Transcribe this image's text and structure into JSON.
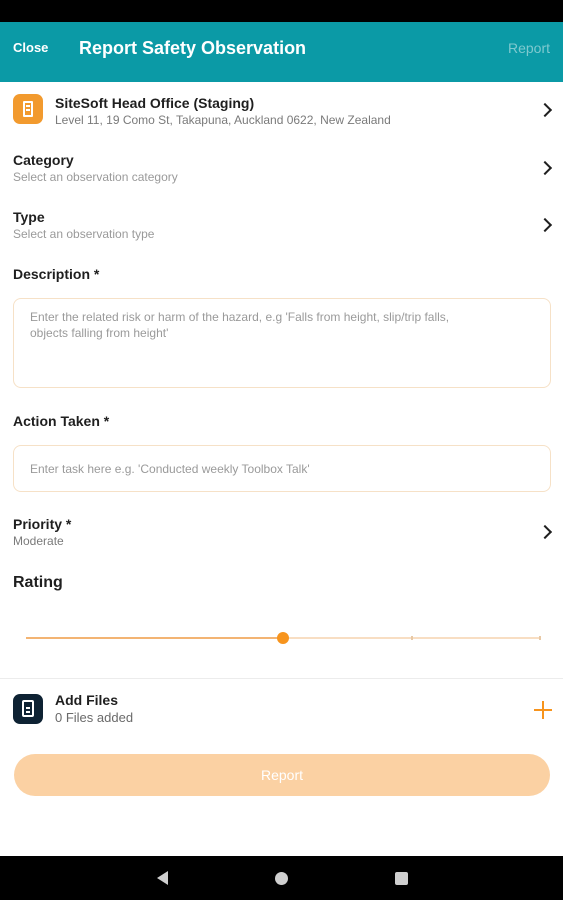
{
  "app_bar": {
    "close_label": "Close",
    "title": "Report Safety Observation",
    "report_label": "Report"
  },
  "site": {
    "icon": "building-icon",
    "name": "SiteSoft Head Office (Staging)",
    "address": "Level 11, 19 Como St, Takapuna, Auckland 0622, New Zealand"
  },
  "category": {
    "label": "Category",
    "placeholder": "Select an observation category"
  },
  "type": {
    "label": "Type",
    "placeholder": "Select an observation type"
  },
  "description": {
    "label": "Description *",
    "placeholder_line1": "Enter the related risk or harm of the hazard, e.g 'Falls from height, slip/trip falls,",
    "placeholder_line2": "objects falling from height'"
  },
  "action_taken": {
    "label": "Action Taken *",
    "placeholder": "Enter task here e.g. 'Conducted weekly Toolbox Talk'"
  },
  "priority": {
    "label": "Priority *",
    "value": "Moderate"
  },
  "rating": {
    "label": "Rating",
    "value_fraction": 0.5,
    "tick_fractions": [
      0.75,
      1.0
    ]
  },
  "files": {
    "icon": "file-icon",
    "label": "Add Files",
    "count_text": "0 Files added"
  },
  "report_button_label": "Report",
  "colors": {
    "app_bar": "#0b9aa6",
    "accent": "#f7941d",
    "button_disabled": "#fbd1a3"
  }
}
